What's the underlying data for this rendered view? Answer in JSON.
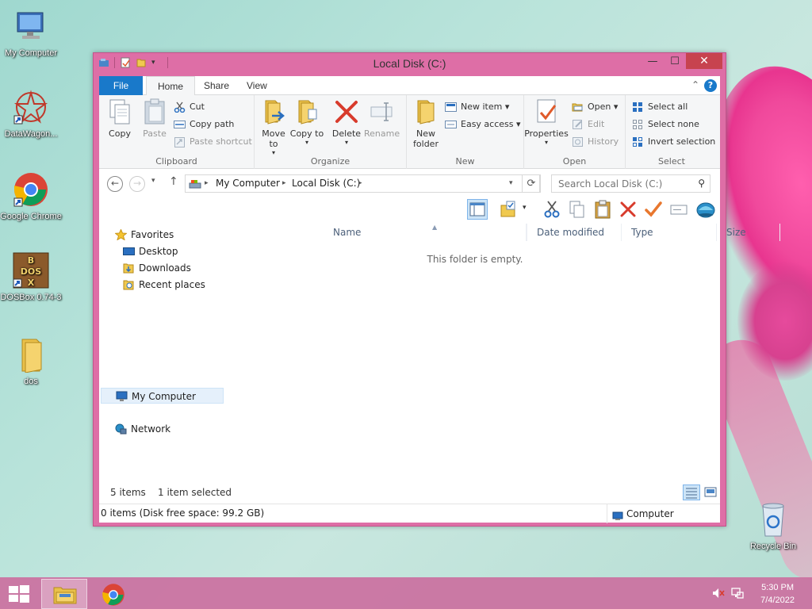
{
  "desktop": {
    "icons": [
      {
        "label": "My Computer"
      },
      {
        "label": "DataWagon..."
      },
      {
        "label": "Google Chrome"
      },
      {
        "label": "DOSBox 0.74-3"
      },
      {
        "label": "dos"
      },
      {
        "label": "Recycle Bin"
      }
    ]
  },
  "window": {
    "title": "Local Disk (C:)",
    "controls": {
      "minimize": "—",
      "maximize": "☐",
      "close": "✕"
    }
  },
  "ribbon": {
    "tabs": {
      "file": "File",
      "home": "Home",
      "share": "Share",
      "view": "View"
    },
    "clipboard": {
      "group": "Clipboard",
      "copy": "Copy",
      "paste": "Paste",
      "cut": "Cut",
      "copy_path": "Copy path",
      "paste_shortcut": "Paste shortcut"
    },
    "organize": {
      "group": "Organize",
      "move_to": "Move to",
      "move_to_arrow": "▾",
      "copy_to": "Copy to",
      "copy_to_arrow": "▾",
      "delete": "Delete",
      "delete_arrow": "▾",
      "rename": "Rename"
    },
    "new": {
      "group": "New",
      "new_folder": "New folder",
      "new_item": "New item ▾",
      "easy_access": "Easy access ▾"
    },
    "open": {
      "group": "Open",
      "properties": "Properties",
      "properties_arrow": "▾",
      "open": "Open ▾",
      "edit": "Edit",
      "history": "History"
    },
    "select": {
      "group": "Select",
      "select_all": "Select all",
      "select_none": "Select none",
      "invert_selection": "Invert selection"
    }
  },
  "address": {
    "crumbs": [
      "My Computer",
      "Local Disk (C:)"
    ],
    "search_placeholder": "Search Local Disk (C:)"
  },
  "navpane": {
    "favorites": "Favorites",
    "desktop": "Desktop",
    "downloads": "Downloads",
    "recent_places": "Recent places",
    "my_computer": "My Computer",
    "network": "Network"
  },
  "filelist": {
    "columns": [
      "Name",
      "Date modified",
      "Type",
      "Size"
    ],
    "empty_message": "This folder is empty."
  },
  "counts": {
    "items": "5 items",
    "selected": "1 item selected"
  },
  "statusbar": {
    "left": "0 items (Disk free space: 99.2 GB)",
    "right": "Computer"
  },
  "taskbar": {
    "time": "5:30 PM",
    "date": "7/4/2022"
  },
  "colors": {
    "window_frame": "#de6ea6",
    "accent_blue": "#1979ca",
    "close_red": "#c7434f",
    "taskbar": "#cb70a0"
  }
}
